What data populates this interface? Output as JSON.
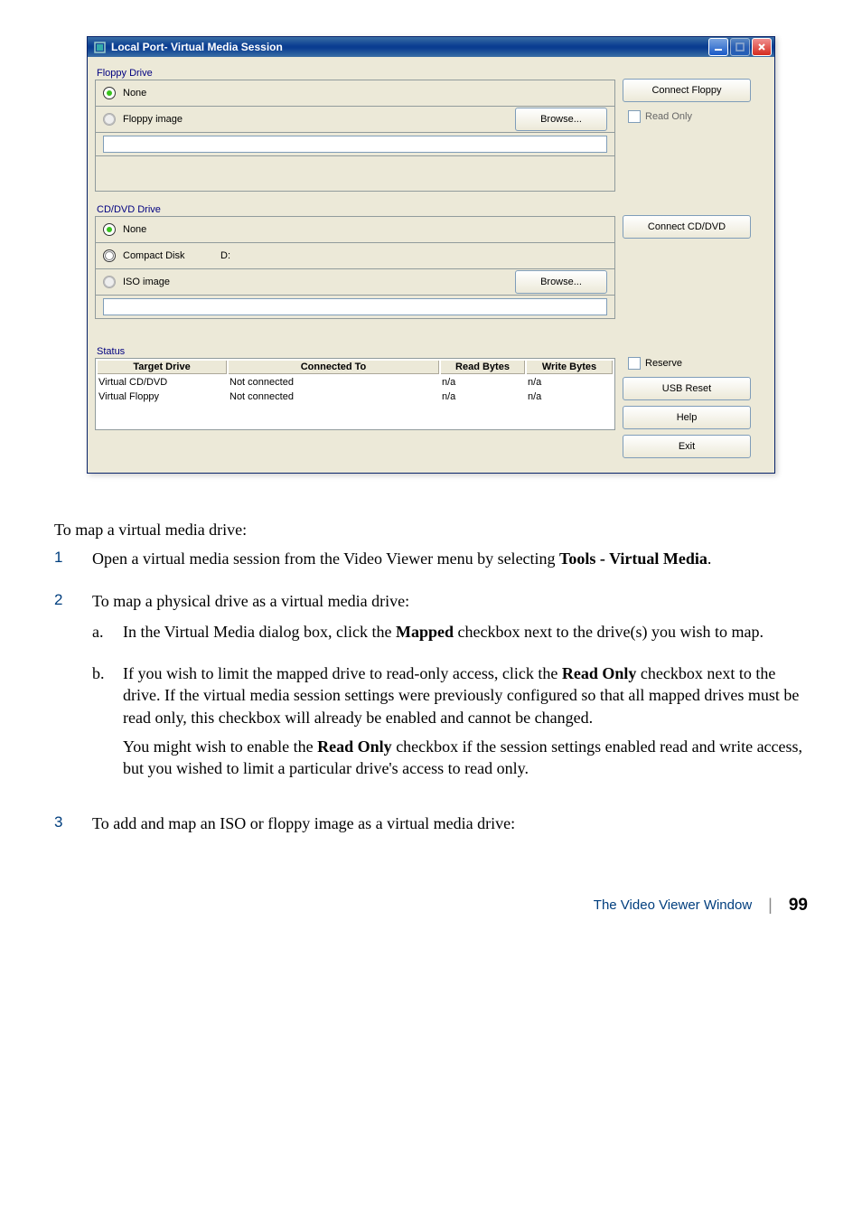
{
  "dialog": {
    "title": "Local Port- Virtual Media Session",
    "floppy": {
      "group": "Floppy Drive",
      "none": "None",
      "image": "Floppy image",
      "browse": "Browse...",
      "connect": "Connect Floppy",
      "readonly": "Read Only"
    },
    "cd": {
      "group": "CD/DVD Drive",
      "none": "None",
      "compact": "Compact Disk",
      "drive": "D:",
      "iso": "ISO image",
      "browse": "Browse...",
      "connect": "Connect CD/DVD"
    },
    "status": {
      "group": "Status",
      "headers": {
        "target": "Target Drive",
        "connected": "Connected To",
        "read": "Read Bytes",
        "write": "Write Bytes"
      },
      "rows": [
        {
          "target": "Virtual CD/DVD",
          "connected": "Not connected",
          "read": "n/a",
          "write": "n/a"
        },
        {
          "target": "Virtual Floppy",
          "connected": "Not connected",
          "read": "n/a",
          "write": "n/a"
        }
      ],
      "reserve": "Reserve",
      "usb": "USB Reset",
      "help": "Help",
      "exit": "Exit"
    }
  },
  "doc": {
    "intro": "To map a virtual media drive:",
    "s1a": "Open a virtual media session from the Video Viewer menu by selecting ",
    "s1b": "Tools - Virtual Media",
    "s1c": ".",
    "s2": "To map a physical drive as a virtual media drive:",
    "s2a1": "In the Virtual Media dialog box, click the ",
    "s2a2": "Mapped",
    "s2a3": " checkbox next to the drive(s) you wish to map.",
    "s2b1": "If you wish to limit the mapped drive to read-only access, click the ",
    "s2b2": "Read Only",
    "s2b3": " checkbox next to the drive. If the virtual media session settings were previously configured so that all mapped drives must be read only, this checkbox will already be enabled and cannot be changed.",
    "s2b4a": "You might wish to enable the ",
    "s2b4b": "Read Only",
    "s2b4c": " checkbox if the session settings enabled read and write access, but you wished to limit a particular drive's access to read only.",
    "s3": "To add and map an ISO or floppy image as a virtual media drive:"
  },
  "footer": {
    "title": "The Video Viewer Window",
    "page": "99"
  }
}
